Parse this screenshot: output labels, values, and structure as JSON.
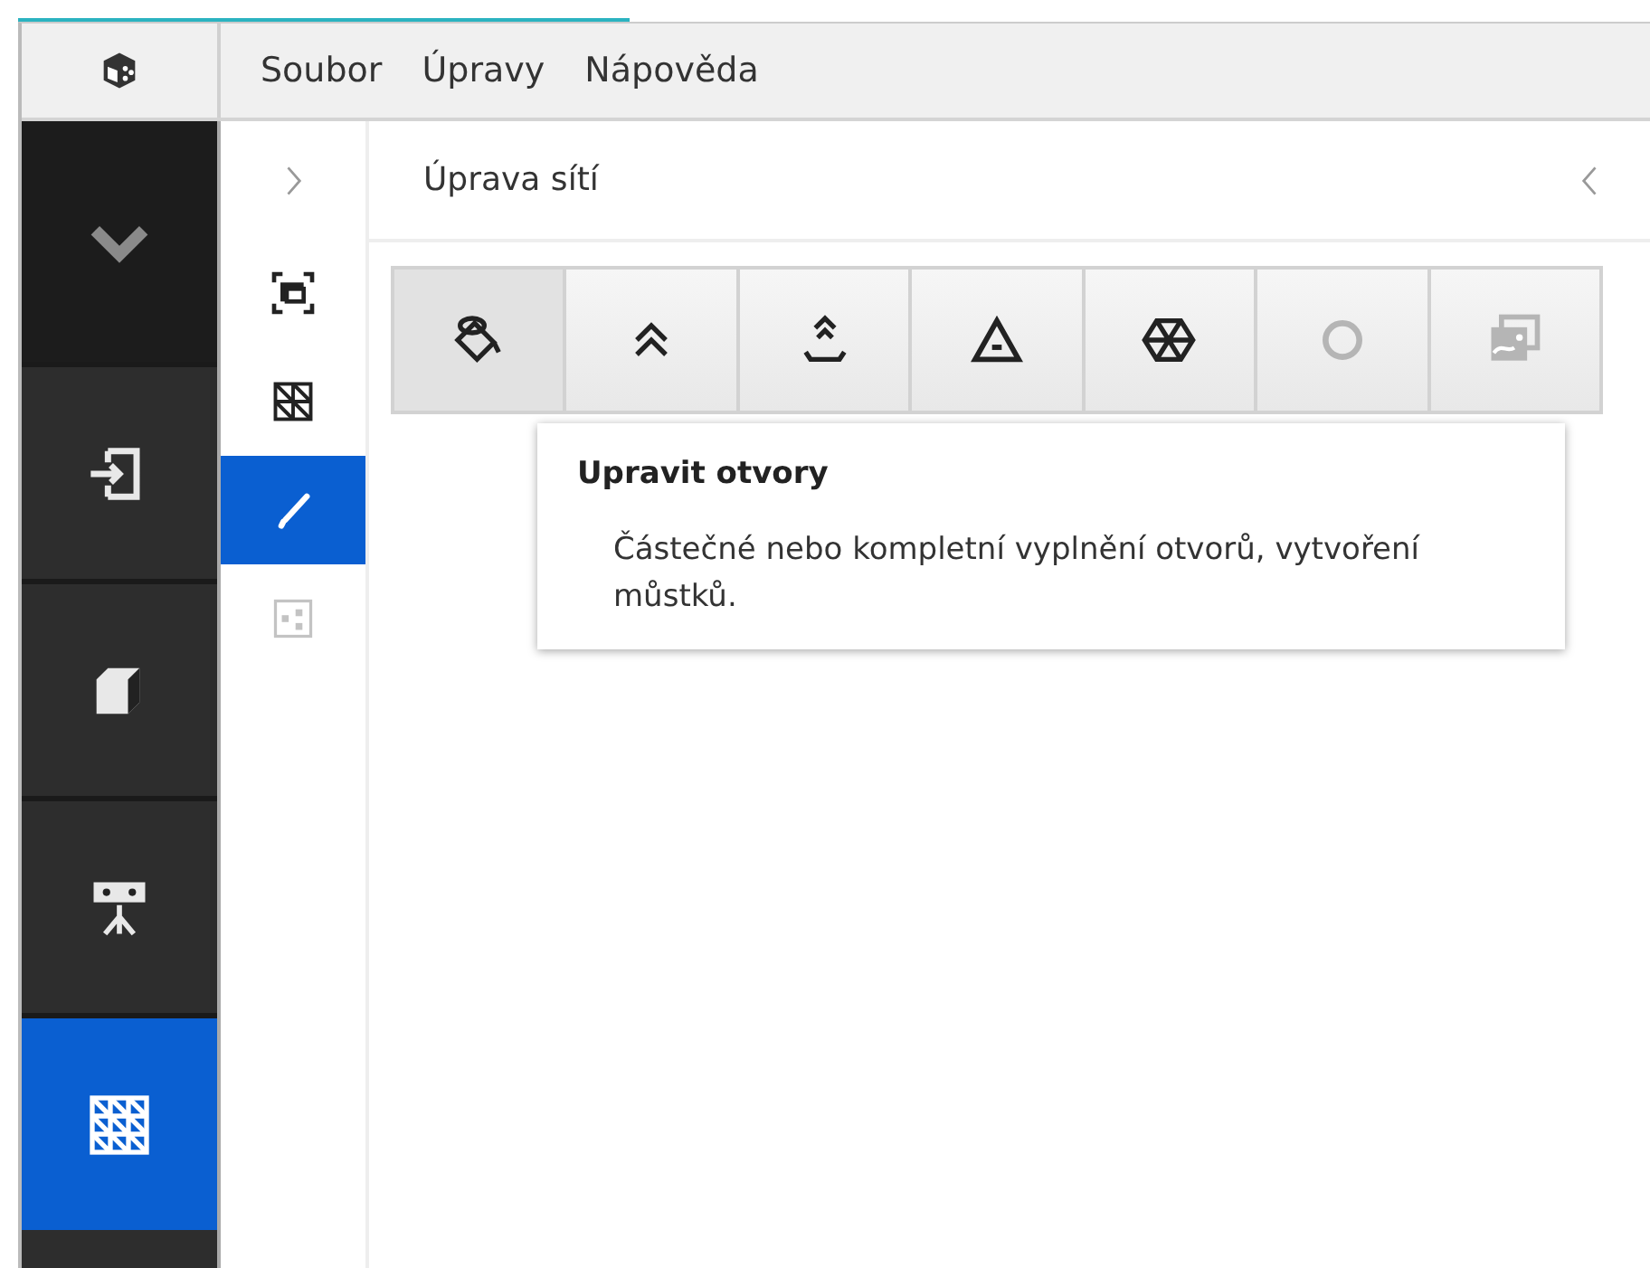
{
  "menu": [
    "Soubor",
    "Úpravy",
    "Nápověda"
  ],
  "sidebar": {
    "items": [
      {
        "selected": false
      },
      {
        "selected": false
      },
      {
        "selected": false
      },
      {
        "selected": true
      }
    ]
  },
  "subtools": [
    {
      "selected": false
    },
    {
      "selected": false
    },
    {
      "selected": true
    },
    {
      "selected": false,
      "disabled": true
    }
  ],
  "panel": {
    "title": "Úprava sítí"
  },
  "tools": [
    {
      "selected": true,
      "disabled": false
    },
    {
      "selected": false,
      "disabled": false
    },
    {
      "selected": false,
      "disabled": false
    },
    {
      "selected": false,
      "disabled": false
    },
    {
      "selected": false,
      "disabled": false
    },
    {
      "selected": false,
      "disabled": true
    },
    {
      "selected": false,
      "disabled": true
    }
  ],
  "tooltip": {
    "title": "Upravit otvory",
    "text": "Částečné nebo kompletní vyplnění otvorů, vytvoření můstků."
  }
}
